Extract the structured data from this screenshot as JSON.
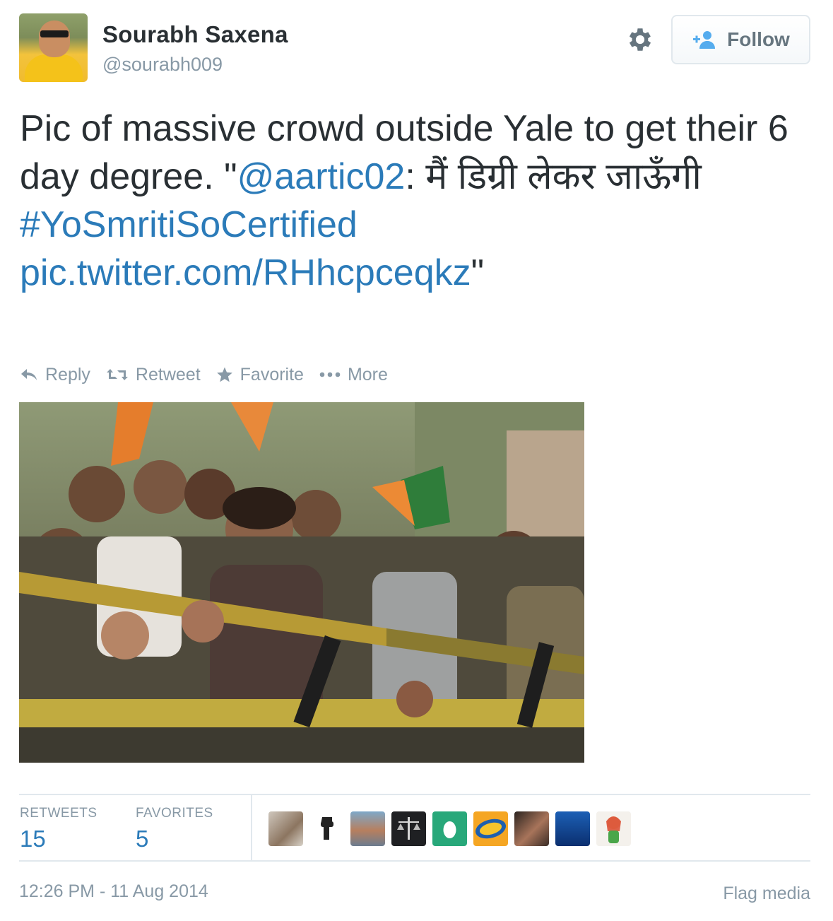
{
  "user": {
    "display_name": "Sourabh Saxena",
    "handle": "@sourabh009"
  },
  "follow_label": "Follow",
  "tweet": {
    "text_part1": "Pic of massive crowd outside Yale to get their 6 day degree. \"",
    "mention": "@aartic02",
    "text_part2": ": मैं डिग्री लेकर जाऊँगी",
    "hashtag": "#YoSmritiSoCertified",
    "pic_link": "pic.twitter.com/RHhcpceqkz",
    "text_end": "\""
  },
  "actions": {
    "reply": "Reply",
    "retweet": "Retweet",
    "favorite": "Favorite",
    "more": "More"
  },
  "stats": {
    "retweets_label": "RETWEETS",
    "retweets_count": "15",
    "favorites_label": "FAVORITES",
    "favorites_count": "5"
  },
  "timestamp": "12:26 PM - 11 Aug 2014",
  "flag_media": "Flag media",
  "colors": {
    "link": "#2b7bb9",
    "muted": "#8899a6",
    "text": "#292f33"
  }
}
